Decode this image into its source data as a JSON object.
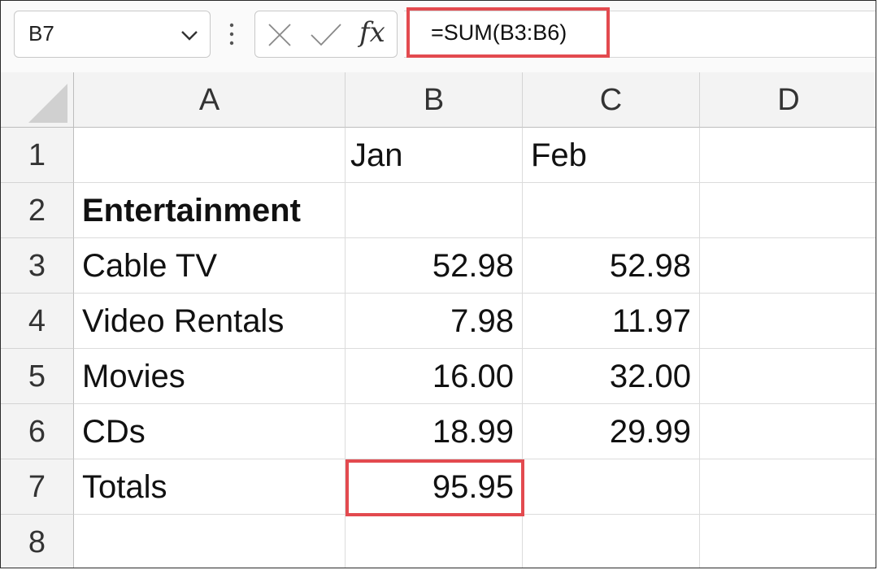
{
  "formula_bar": {
    "name_box": "B7",
    "formula": "=SUM(B3:B6)",
    "fx_label": "fx"
  },
  "columns": [
    "A",
    "B",
    "C",
    "D"
  ],
  "rows": [
    "1",
    "2",
    "3",
    "4",
    "5",
    "6",
    "7",
    "8"
  ],
  "cells": {
    "B1": "Jan",
    "C1": "Feb",
    "A2": "Entertainment",
    "A3": "Cable TV",
    "B3": "52.98",
    "C3": "52.98",
    "A4": "Video Rentals",
    "B4": "7.98",
    "C4": "11.97",
    "A5": "Movies",
    "B5": "16.00",
    "C5": "32.00",
    "A6": "CDs",
    "B6": "18.99",
    "C6": "29.99",
    "A7": "Totals",
    "B7": "95.95"
  },
  "highlight_color": "#e34a4f",
  "selected_cell": "B7"
}
